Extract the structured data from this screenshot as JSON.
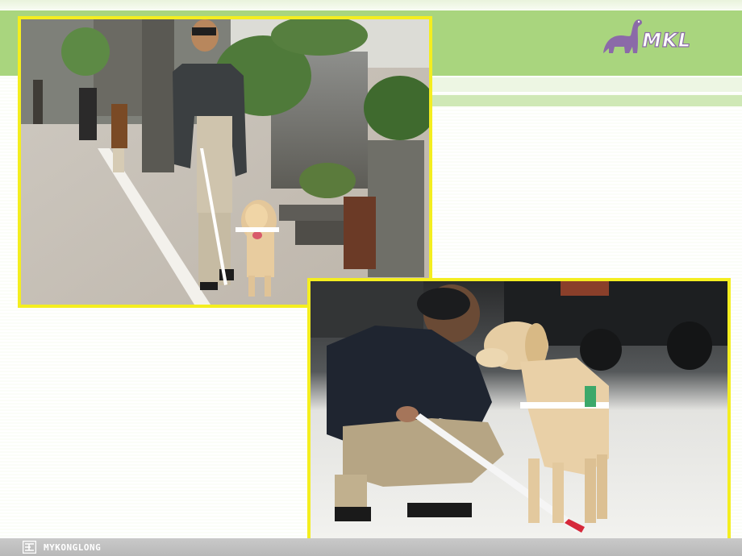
{
  "slide": {
    "brand_logo_text": "MKL",
    "footer_text": "MYKONGLONG",
    "colors": {
      "green_band": "#a9d57e",
      "photo_border": "#f4ee1f",
      "logo_purple": "#8b6aa8",
      "footer_gray": "#bdbdbd"
    }
  },
  "photos": [
    {
      "name": "man-walking-with-guide-dog",
      "icon": "photo"
    },
    {
      "name": "man-kneeling-with-guide-dog",
      "icon": "photo"
    }
  ]
}
